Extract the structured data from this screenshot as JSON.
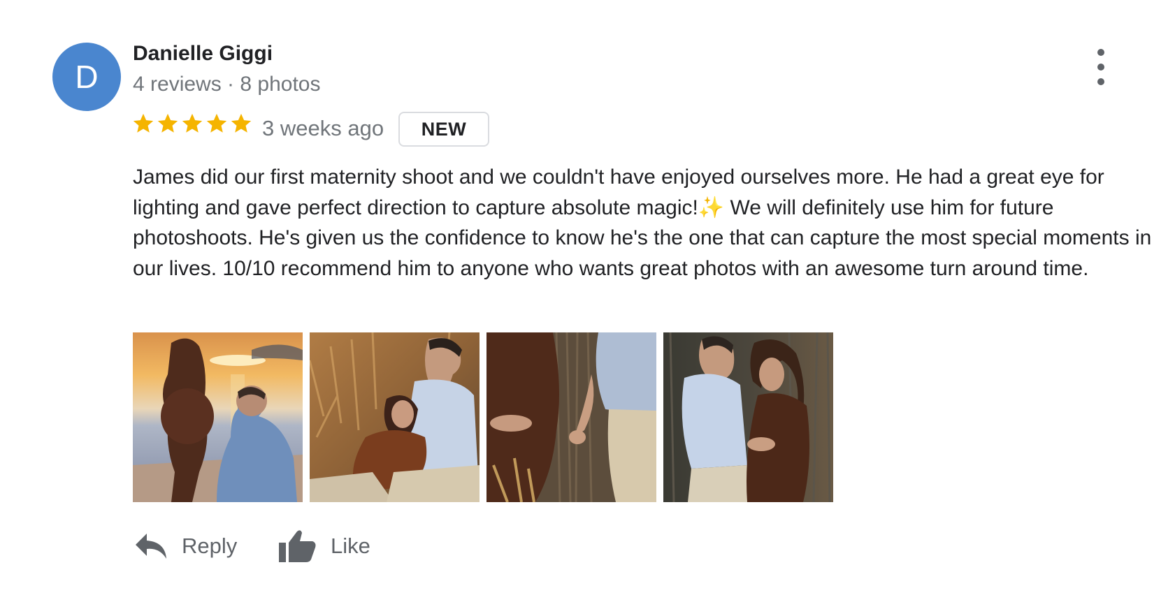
{
  "reviewer": {
    "initial": "D",
    "name": "Danielle Giggi",
    "meta": "4 reviews · 8 photos",
    "avatar_color": "#4a86cf"
  },
  "review": {
    "rating": 5,
    "max_rating": 5,
    "star_color": "#f5b400",
    "time_ago": "3 weeks ago",
    "badge": "NEW",
    "text": "James did our first maternity shoot and we couldn't have enjoyed ourselves more. He had a great eye for lighting and gave perfect direction to capture absolute magic!✨ We will definitely use him for future photoshoots. He's given us the confidence to know he's the one that can capture the most special moments in our lives. 10/10 recommend him to anyone who wants great photos with an awesome turn around time.",
    "photo_count": 4
  },
  "actions": {
    "reply_label": "Reply",
    "like_label": "Like",
    "reply_icon": "reply-arrow-icon",
    "like_icon": "thumbs-up-icon",
    "more_icon": "more-vertical-icon"
  }
}
